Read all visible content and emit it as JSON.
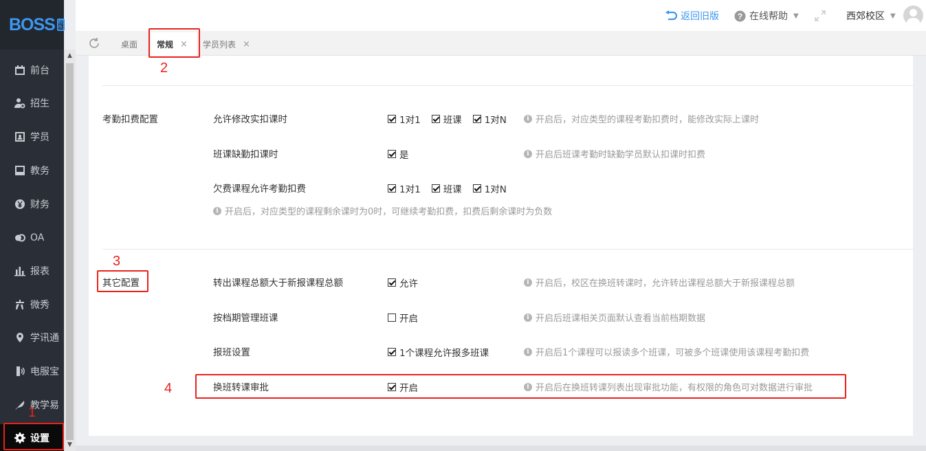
{
  "logo": {
    "text": "BOSS",
    "badge": "校长"
  },
  "sidebar": {
    "items": [
      {
        "label": "前台",
        "icon": "calendar-icon"
      },
      {
        "label": "招生",
        "icon": "user-plus-icon"
      },
      {
        "label": "学员",
        "icon": "id-card-icon"
      },
      {
        "label": "教务",
        "icon": "book-icon"
      },
      {
        "label": "财务",
        "icon": "yen-icon"
      },
      {
        "label": "OA",
        "icon": "oa-icon"
      },
      {
        "label": "报表",
        "icon": "bar-chart-icon"
      },
      {
        "label": "微秀",
        "icon": "xiu-icon"
      },
      {
        "label": "学讯通",
        "icon": "map-pin-icon"
      },
      {
        "label": "电服宝",
        "icon": "phone-icon"
      },
      {
        "label": "教学易",
        "icon": "feather-icon"
      },
      {
        "label": "设置",
        "icon": "gear-icon",
        "active": true
      }
    ]
  },
  "header": {
    "back_old": "返回旧版",
    "help": "在线帮助",
    "campus": "西郊校区"
  },
  "tabs": [
    {
      "label": "桌面",
      "closable": false
    },
    {
      "label": "常规",
      "closable": true,
      "active": true
    },
    {
      "label": "学员列表",
      "closable": true
    }
  ],
  "sections": {
    "attendance": {
      "title": "考勤扣费配置",
      "rows": [
        {
          "label": "允许修改实扣课时",
          "options": [
            {
              "label": "1对1",
              "checked": true
            },
            {
              "label": "班课",
              "checked": true
            },
            {
              "label": "1对N",
              "checked": true
            }
          ],
          "hint": "开启后，对应类型的课程考勤扣费时，能修改实际上课时"
        },
        {
          "label": "班课缺勤扣课时",
          "options": [
            {
              "label": "是",
              "checked": true
            }
          ],
          "hint": "开启后班课考勤时缺勤学员默认扣课时扣费"
        },
        {
          "label": "欠费课程允许考勤扣费",
          "options": [
            {
              "label": "1对1",
              "checked": true
            },
            {
              "label": "班课",
              "checked": true
            },
            {
              "label": "1对N",
              "checked": true
            }
          ],
          "hint": "开启后，对应类型的课程剩余课时为0时，可继续考勤扣费，扣费后剩余课时为负数"
        }
      ]
    },
    "other": {
      "title": "其它配置",
      "rows": [
        {
          "label": "转出课程总额大于新报课程总额",
          "options": [
            {
              "label": "允许",
              "checked": true
            }
          ],
          "hint": "开启后，校区在换班转课时，允许转出课程总额大于新报课程总额"
        },
        {
          "label": "按档期管理班课",
          "options": [
            {
              "label": "开启",
              "checked": false
            }
          ],
          "hint": "开启后班课相关页面默认查看当前档期数据"
        },
        {
          "label": "报班设置",
          "options": [
            {
              "label": "1个课程允许报多班课",
              "checked": true
            }
          ],
          "hint": "开启后1个课程可以报读多个班课，可被多个班课使用该课程考勤扣费"
        },
        {
          "label": "换班转课审批",
          "options": [
            {
              "label": "开启",
              "checked": true
            }
          ],
          "hint": "开启后在换班转课列表出现审批功能，有权限的角色可对数据进行审批"
        }
      ]
    }
  },
  "annotations": [
    "1",
    "2",
    "3",
    "4"
  ],
  "colors": {
    "sidebar_bg": "#2a2e36",
    "accent": "#3e97f0",
    "annotation_red": "#e8221b"
  }
}
